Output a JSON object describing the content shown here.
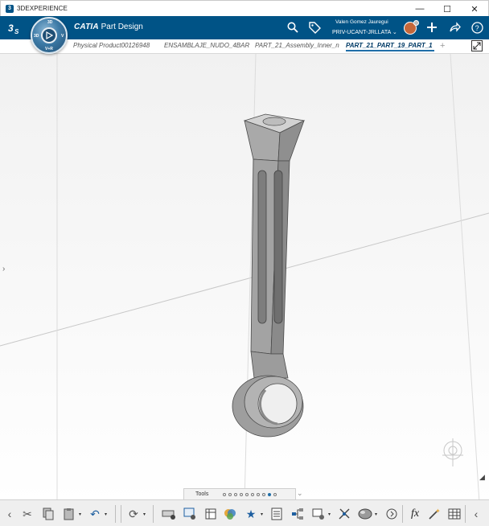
{
  "window": {
    "title": "3DEXPERIENCE",
    "controls": {
      "minimize": "—",
      "maximize": "☐",
      "close": "✕"
    }
  },
  "header": {
    "logo": "3DS",
    "app_brand": "CATIA",
    "app_name": "Part Design",
    "compass_labels": {
      "top": "3D",
      "left": "3D",
      "right": "V",
      "bottom": "V+R"
    },
    "user_name": "Valen Gomez Jauregui",
    "user_role": "PRIV-UCANT-JRLLATA",
    "icons": [
      "search-icon",
      "tag-icon",
      "plus-icon",
      "share-icon",
      "help-icon"
    ],
    "color": "#005386"
  },
  "tabs": [
    {
      "label": "Physical Product00126948",
      "active": false
    },
    {
      "label": "ENSAMBLAJE_NUDO_4BAR",
      "active": false
    },
    {
      "label": "PART_21_Assembly_Inner_n",
      "active": false
    },
    {
      "label": "PART_21_PART_19_PART_1",
      "active": true
    }
  ],
  "tab_add": "+",
  "tools": {
    "label": "Tools",
    "pages": 10,
    "active_page": 9
  },
  "toolbar": {
    "items": [
      "scissors-icon",
      "copy-icon",
      "paste-icon",
      "undo-icon",
      "update-icon",
      "measure-icon",
      "capture-icon",
      "table-icon",
      "material-icon",
      "favorites-icon",
      "list-icon",
      "tree-icon",
      "properties-icon",
      "compass-icon",
      "render-icon",
      "more-icon",
      "formula-icon",
      "magic-icon",
      "grid-icon",
      "prev-icon"
    ],
    "formula_label": "fx"
  },
  "colors": {
    "header": "#005386",
    "accent": "#1f6ea8",
    "part": "#9a9a9a"
  }
}
